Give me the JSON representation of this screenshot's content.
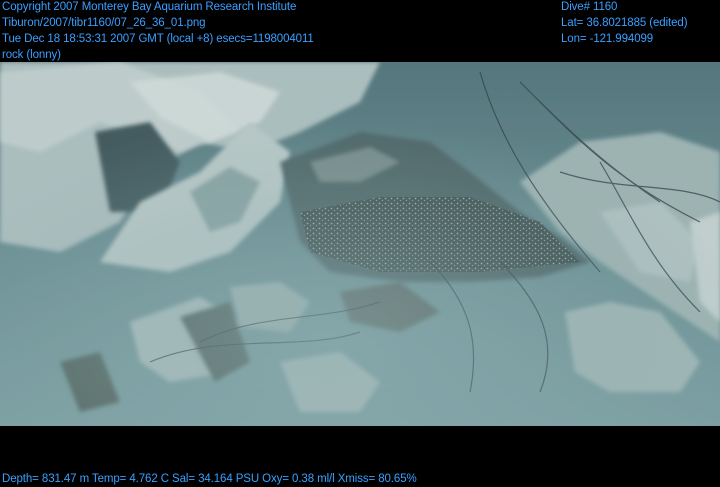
{
  "header_left": {
    "copyright": "Copyright 2007 Monterey Bay Aquarium Research Institute",
    "file": "Tiburon/2007/tibr1160/07_26_36_01.png",
    "timestamp": "Tue Dec 18 18:53:31 2007 GMT (local +8)  esecs=1198004011",
    "label": "rock (lonny)"
  },
  "header_right": {
    "dive": "Dive# 1160",
    "lat": "Lat= 36.8021885 (edited)",
    "lon": "Lon= -121.994099"
  },
  "footer": {
    "telemetry": "Depth= 831.47 m  Temp= 4.762 C  Sal= 34.164 PSU  Oxy= 0.38 ml/l  Xmiss= 80.65%"
  },
  "image": {
    "subject": "underwater-seafloor-rocks",
    "water_color": "#5e8288",
    "text_color": "#3aa0ff"
  }
}
